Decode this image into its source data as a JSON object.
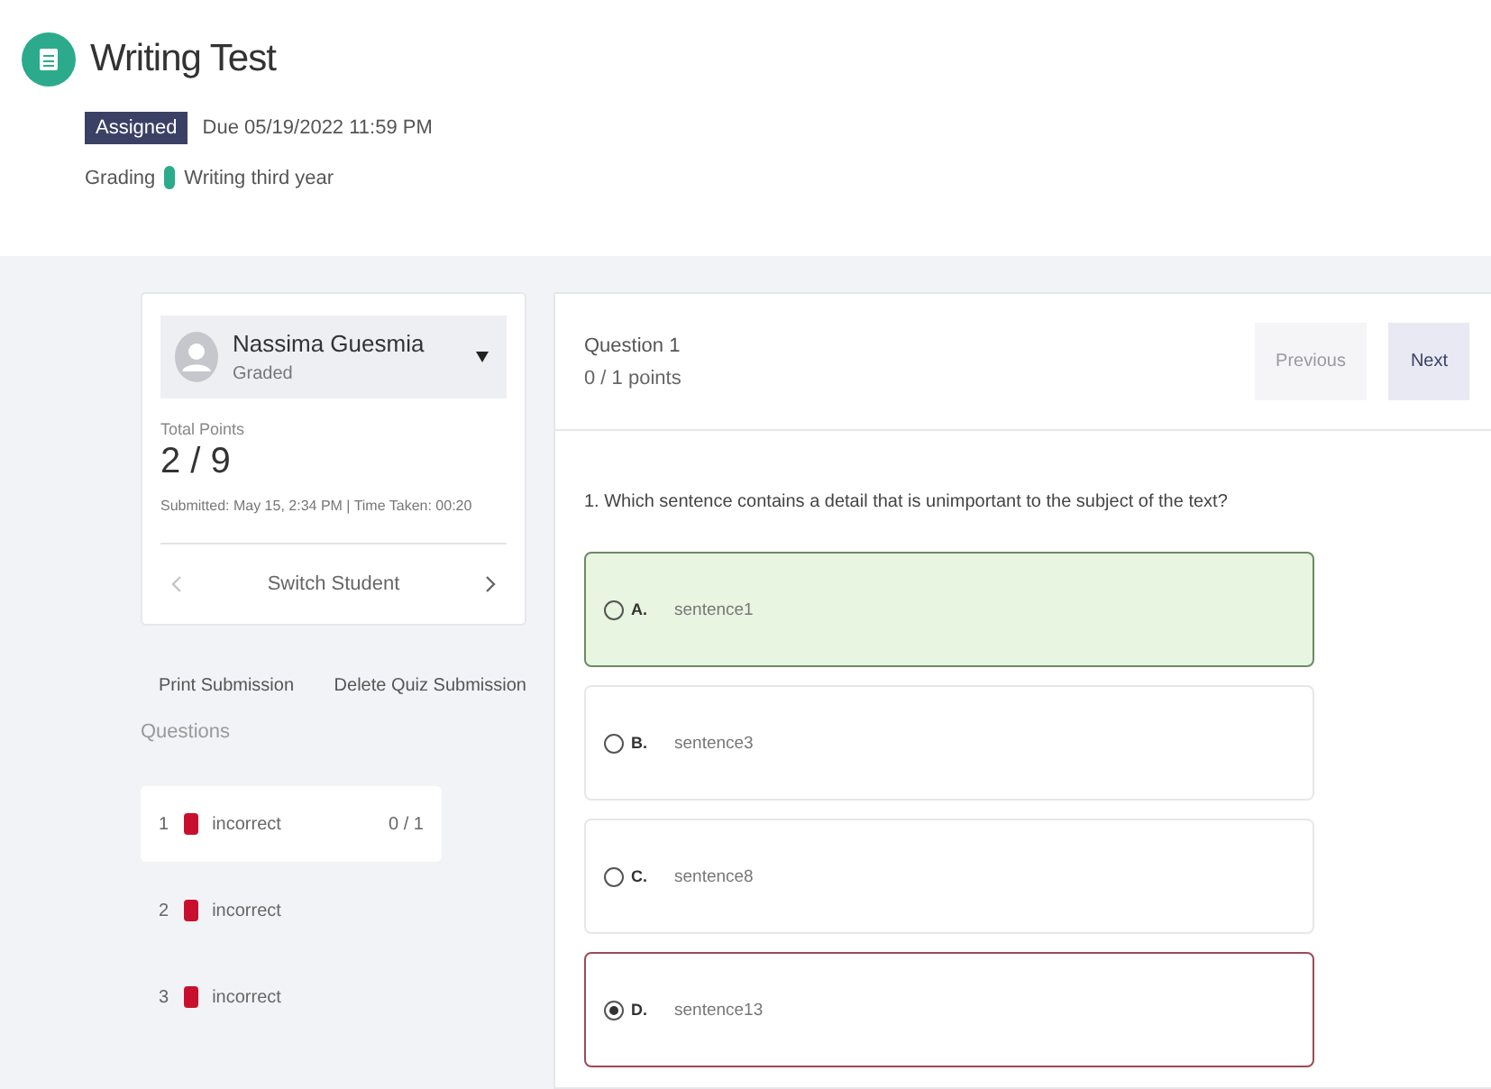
{
  "header": {
    "title": "Writing Test",
    "badge": "Assigned",
    "due": "Due 05/19/2022 11:59 PM",
    "grading_label": "Grading",
    "grading_value": "Writing third year"
  },
  "student": {
    "name": "Nassima Guesmia",
    "status": "Graded",
    "total_label": "Total Points",
    "total": "2 / 9",
    "submitted": "Submitted: May 15, 2:34 PM | Time Taken: 00:20",
    "switch_label": "Switch Student",
    "prev_disabled": true,
    "next_disabled": false
  },
  "actions": [
    "Print Submission",
    "Delete Quiz Submission"
  ],
  "questions_label": "Questions",
  "questions": [
    {
      "number": "1",
      "status": "incorrect",
      "color": "#c8102e",
      "score": "0 / 1",
      "selected": true
    },
    {
      "number": "2",
      "status": "incorrect",
      "color": "#c8102e",
      "selected": false
    },
    {
      "number": "3",
      "status": "incorrect",
      "color": "#c8102e",
      "selected": false
    }
  ],
  "question": {
    "title": "Question 1",
    "points": "0 / 1 points",
    "previous": {
      "label": "Previous",
      "disabled": true
    },
    "next": {
      "label": "Next",
      "disabled": false
    },
    "text": "1. Which sentence contains a detail that is unimportant to the subject of the text?",
    "options": [
      {
        "letter": "A.",
        "text": "sentence1",
        "kind": "correct",
        "selected": false
      },
      {
        "letter": "B.",
        "text": "sentence3",
        "kind": "plain",
        "selected": false
      },
      {
        "letter": "C.",
        "text": "sentence8",
        "kind": "plain",
        "selected": false
      },
      {
        "letter": "D.",
        "text": "sentence13",
        "kind": "wrong",
        "selected": true
      }
    ]
  }
}
